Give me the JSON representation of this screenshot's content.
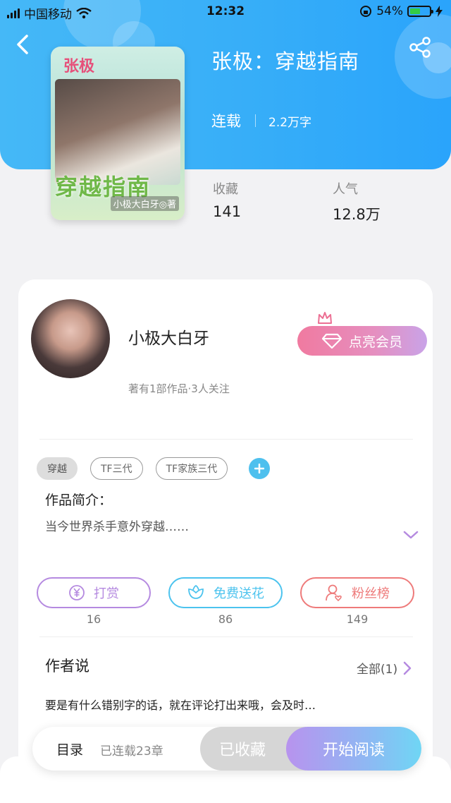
{
  "status_bar": {
    "carrier": "中国移动",
    "time": "12:32",
    "battery_pct": "54%",
    "battery_level": 0.54
  },
  "book": {
    "title": "张极：穿越指南",
    "status": "连载",
    "word_count": "2.2万字",
    "favorites_label": "收藏",
    "favorites_value": "141",
    "popularity_label": "人气",
    "popularity_value": "12.8万",
    "cover": {
      "top_text": "张极",
      "title": "穿越指南",
      "author": "小极大白牙◎著"
    }
  },
  "author": {
    "name": "小极大白牙",
    "meta": "著有1部作品·3人关注",
    "vip_label": "点亮会员"
  },
  "tags": [
    "穿越",
    "TF三代",
    "TF家族三代"
  ],
  "intro": {
    "label": "作品简介：",
    "text": "当今世界杀手意外穿越……"
  },
  "actions": [
    {
      "label": "打赏",
      "count": "16",
      "color": "#b58ae0",
      "icon": "yuan-icon"
    },
    {
      "label": "免费送花",
      "count": "86",
      "color": "#4cc3ee",
      "icon": "flower-icon"
    },
    {
      "label": "粉丝榜",
      "count": "149",
      "color": "#ee7a7a",
      "icon": "fan-user-icon"
    }
  ],
  "author_say": {
    "label": "作者说",
    "all_link": "全部(1)",
    "text": "要是有什么错别字的话，就在评论打出来哦，会及时…"
  },
  "bottom_bar": {
    "toc_label": "目录",
    "chapters": "已连载23章",
    "favorited_label": "已收藏",
    "read_label": "开始阅读"
  }
}
